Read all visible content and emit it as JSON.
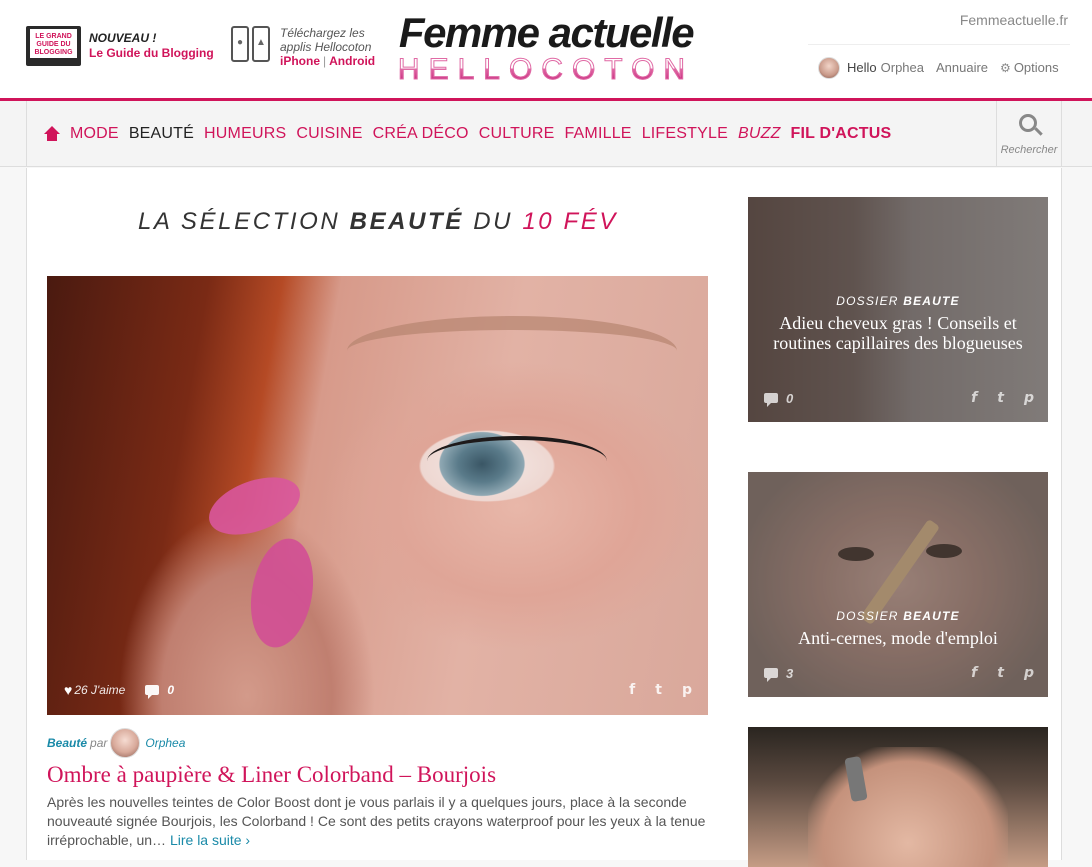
{
  "header": {
    "promo": {
      "book_cover": "LE GRAND GUIDE DU BLOGGING",
      "badge": "NOUVEAU !",
      "link": "Le Guide du Blogging"
    },
    "apps": {
      "text": "Téléchargez les applis Hellocoton",
      "iphone": "iPhone",
      "android": "Android",
      "separator": "|"
    },
    "logo": {
      "top": "Femme actuelle",
      "bottom": "HELLOCOTON"
    },
    "site_link": "Femmeactuelle.fr",
    "user": {
      "hello": "Hello",
      "name": "Orphea",
      "annuaire": "Annuaire",
      "options": "Options"
    }
  },
  "nav": {
    "items": [
      {
        "label": "MODE"
      },
      {
        "label": "BEAUTÉ"
      },
      {
        "label": "HUMEURS"
      },
      {
        "label": "CUISINE"
      },
      {
        "label": "CRÉA DÉCO"
      },
      {
        "label": "CULTURE"
      },
      {
        "label": "FAMILLE"
      },
      {
        "label": "LIFESTYLE"
      },
      {
        "label": "BUZZ"
      },
      {
        "label": "FIL D'ACTUS"
      }
    ],
    "search_label": "Rechercher"
  },
  "selection": {
    "prefix": "LA SÉLECTION",
    "category": "BEAUTÉ",
    "middle": "DU",
    "date": "10 FÉV"
  },
  "hero": {
    "likes": "26",
    "likes_label": "J'aime",
    "comments": "0",
    "share": {
      "facebook": "f",
      "twitter": "t",
      "pinterest": "p"
    }
  },
  "article": {
    "category": "Beauté",
    "by": "par",
    "author": "Orphea",
    "title": "Ombre à paupière & Liner Colorband – Bourjois",
    "excerpt": "Après les nouvelles teintes de Color Boost dont je vous parlais il y a quelques jours, place à la seconde nouveauté signée Bourjois, les Colorband ! Ce sont des petits crayons waterproof pour les yeux à la tenue irréprochable, un…",
    "read_more": "Lire la suite ›"
  },
  "sidebar": {
    "cards": [
      {
        "kicker": "DOSSIER",
        "kicker_bold": "BEAUTE",
        "title": "Adieu cheveux gras ! Conseils et routines capillaires des blogueuses",
        "comments": "0"
      },
      {
        "kicker": "DOSSIER",
        "kicker_bold": "BEAUTE",
        "title": "Anti-cernes, mode d'emploi",
        "comments": "3"
      }
    ]
  },
  "colors": {
    "accent": "#d0145a",
    "link": "#1a8aa8",
    "text": "#555555"
  }
}
